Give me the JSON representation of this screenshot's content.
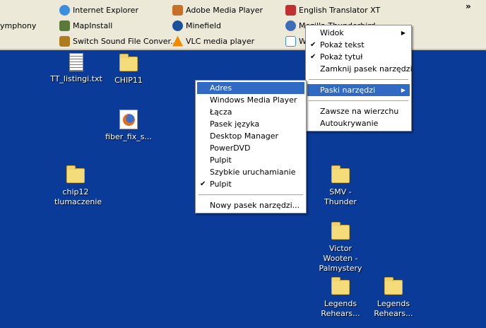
{
  "toolbar": {
    "items": [
      {
        "label": "ymphony"
      },
      {
        "label": "Internet Explorer",
        "color": "#3a8ee0"
      },
      {
        "label": "MapInstall",
        "color": "#5b7a3a"
      },
      {
        "label": "Switch Sound File Conver...",
        "color": "#b07a20"
      },
      {
        "label": "Adobe Media Player",
        "color": "#c8702a"
      },
      {
        "label": "Minefield",
        "color": "#1c4f9c"
      },
      {
        "label": "VLC media player",
        "color": "#f08a00"
      },
      {
        "label": "English Translator XT",
        "color": "#c03030"
      },
      {
        "label": "Mozilla Thunderbird",
        "color": "#3d6cb8"
      },
      {
        "label": "W",
        "color": "#3a8ee0"
      }
    ],
    "overflow": "»"
  },
  "menu_main": {
    "items": [
      {
        "label": "Widok",
        "arrow": "▶"
      },
      {
        "label": "Pokaż tekst",
        "check": "✔"
      },
      {
        "label": "Pokaż tytuł",
        "check": "✔"
      },
      {
        "label": "Zamknij pasek narzędzi"
      },
      {
        "label": "Paski narzędzi",
        "arrow": "▶"
      },
      {
        "label": "Zawsze na wierzchu"
      },
      {
        "label": "Autoukrywanie"
      }
    ]
  },
  "menu_toolbars": {
    "items": [
      {
        "label": "Adres"
      },
      {
        "label": "Windows Media Player"
      },
      {
        "label": "Łącza"
      },
      {
        "label": "Pasek języka"
      },
      {
        "label": "Desktop Manager"
      },
      {
        "label": "PowerDVD"
      },
      {
        "label": "Pulpit"
      },
      {
        "label": "Szybkie uruchamianie"
      },
      {
        "label": "Pulpit",
        "check": "✔"
      },
      {
        "label": "Nowy pasek narzędzi..."
      }
    ]
  },
  "desktop": {
    "icons": [
      {
        "label": "TT_listingi.txt"
      },
      {
        "label": "CHIP11"
      },
      {
        "label": "fiber_fix_s..."
      },
      {
        "label": "chip12 tlumaczenie"
      },
      {
        "label": "SMV - Thunder"
      },
      {
        "label": "Victor Wooten - Palmystery"
      },
      {
        "label": "Legends Rehears..."
      },
      {
        "label": "Legends Rehears..."
      }
    ]
  }
}
